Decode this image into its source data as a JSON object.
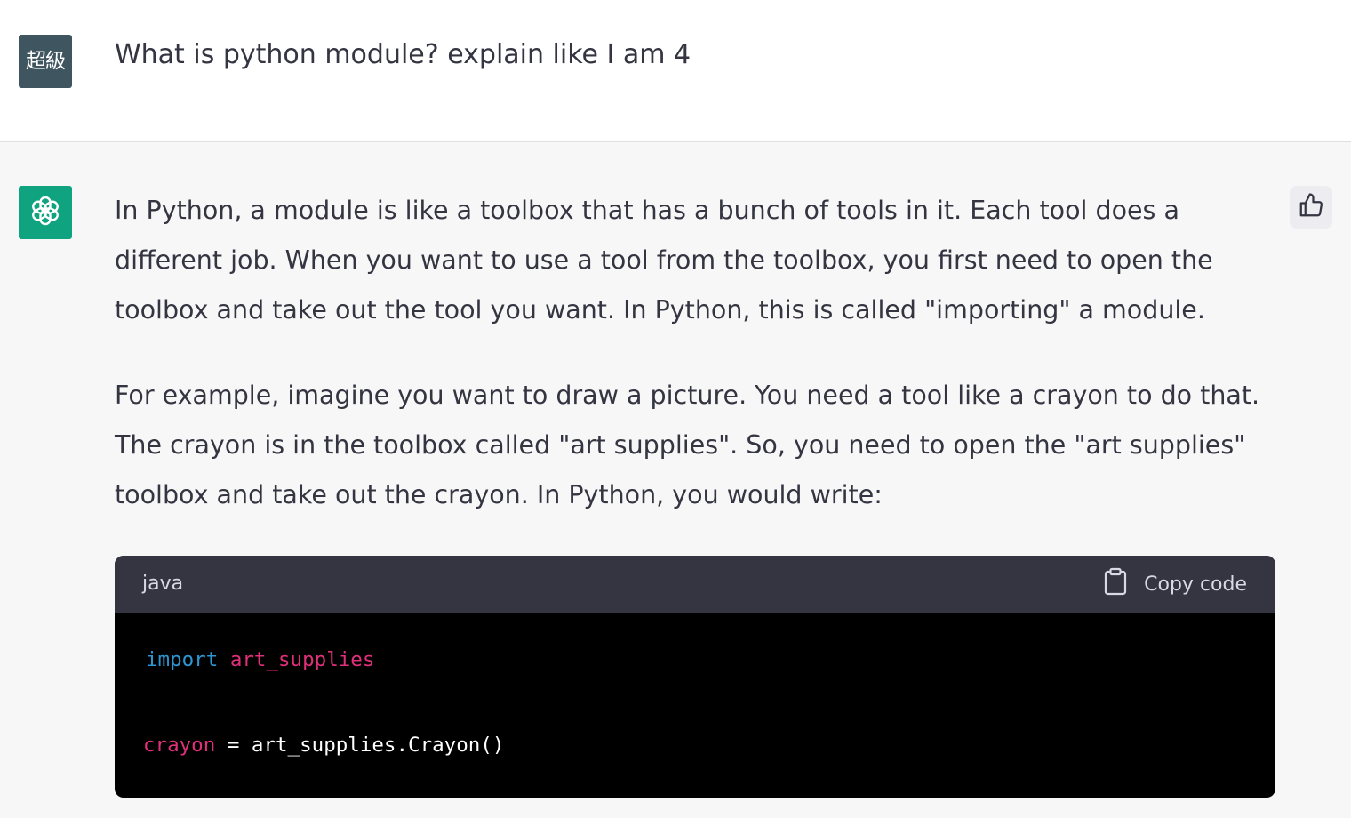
{
  "user_message": {
    "avatar_text": "超級",
    "text": "What is python module? explain like I am 4"
  },
  "assistant_message": {
    "avatar_icon": "openai-logo-icon",
    "paragraph1": [
      "In Python, a module is like a toolbox that has a bunch of tools in it. Each tool does a",
      "different job. When you want to use a tool from the toolbox, you first need to open the",
      "toolbox and take out the tool you want. In Python, this is called \"importing\" a module."
    ],
    "paragraph2": [
      "For example, imagine you want to draw a picture. You need a tool like a crayon to do that.",
      "The crayon is in the toolbox called \"art supplies\". So, you need to open the \"art supplies\"",
      "toolbox and take out the crayon. In Python, you would write:"
    ],
    "code_block": {
      "language": "java",
      "copy_label": "Copy code",
      "line1": {
        "keyword": "import",
        "name": "art_supplies"
      },
      "line2": {
        "variable": "crayon",
        "rest": " = art_supplies.Crayon()"
      }
    }
  },
  "colors": {
    "user_avatar": "#3f5560",
    "assistant_avatar": "#10a37f",
    "code_keyword": "#2e95d3",
    "code_variable": "#df3079"
  }
}
